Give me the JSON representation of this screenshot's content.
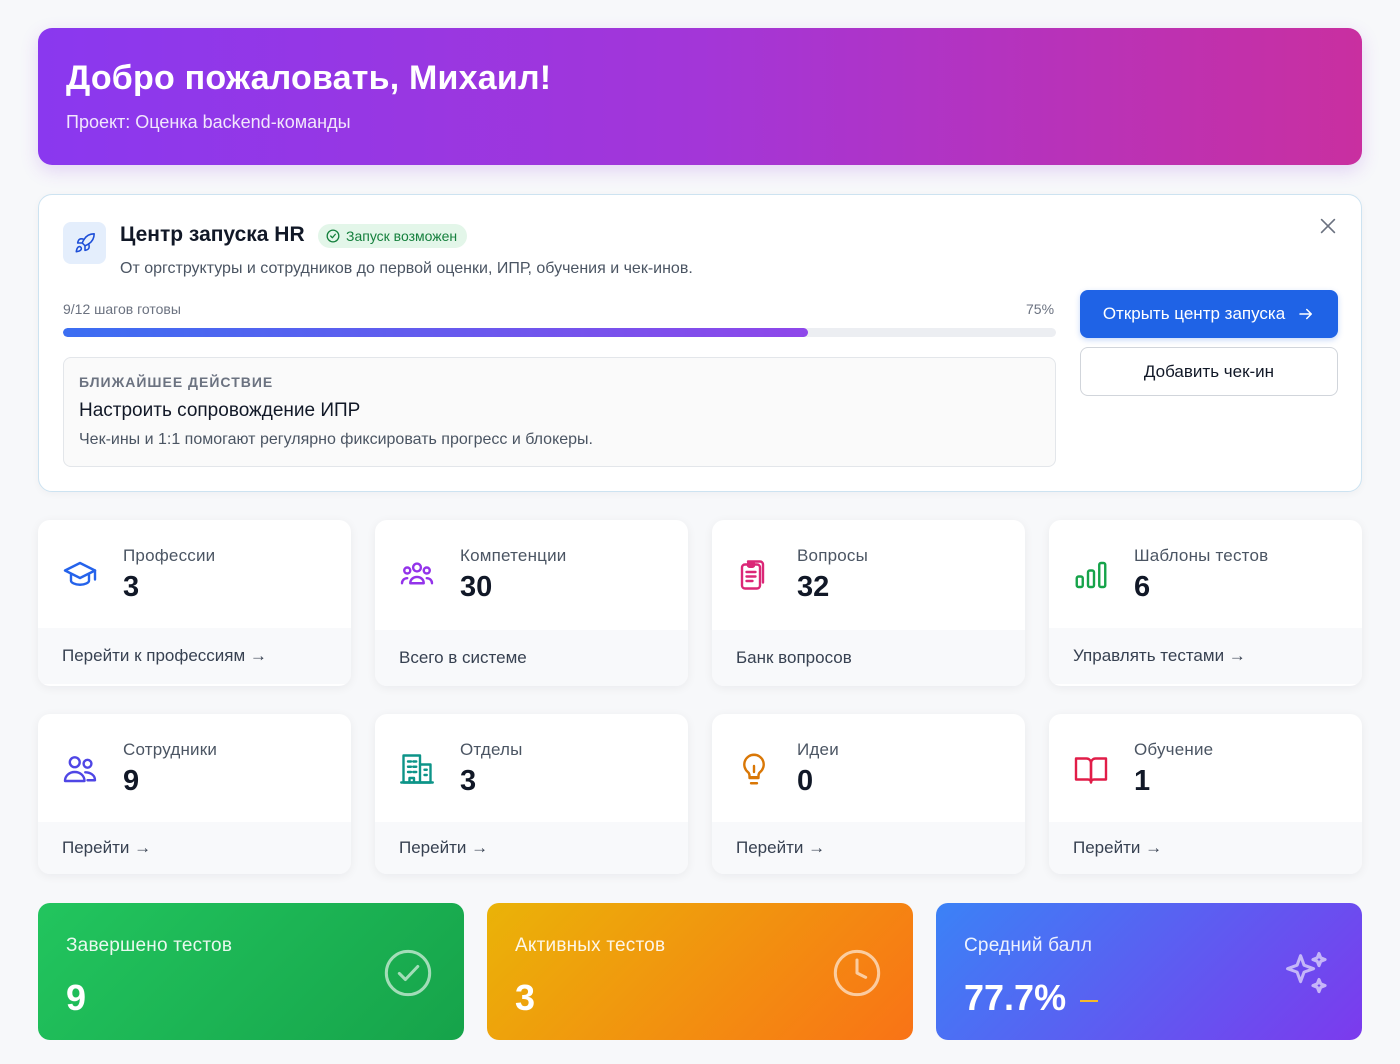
{
  "hero": {
    "title": "Добро пожаловать, Михаил!",
    "subtitle": "Проект: Оценка backend-команды"
  },
  "launch": {
    "title": "Центр запуска HR",
    "badge": "Запуск возможен",
    "subtitle": "От оргструктуры и сотрудников до первой оценки, ИПР, обучения и чек-инов.",
    "progress_label": "9/12 шагов готовы",
    "progress_percent_text": "75%",
    "progress_value": 0.75,
    "next_kicker": "БЛИЖАЙШЕЕ ДЕЙСТВИЕ",
    "next_title": "Настроить сопровождение ИПР",
    "next_desc": "Чек-ины и 1:1 помогают регулярно фиксировать прогресс и блокеры.",
    "primary_button": "Открыть центр запуска",
    "secondary_button": "Добавить чек-ин"
  },
  "cards": [
    {
      "icon": "graduation-cap-icon",
      "color": "#2563eb",
      "label": "Профессии",
      "value": "3",
      "footer": "Перейти к профессиям →"
    },
    {
      "icon": "users-group-icon",
      "color": "#9333ea",
      "label": "Компетенции",
      "value": "30",
      "footer": "Всего в системе"
    },
    {
      "icon": "clipboard-list-icon",
      "color": "#db2777",
      "label": "Вопросы",
      "value": "32",
      "footer": "Банк вопросов"
    },
    {
      "icon": "bar-chart-icon",
      "color": "#16a34a",
      "label": "Шаблоны тестов",
      "value": "6",
      "footer": "Управлять тестами →"
    },
    {
      "icon": "users-icon",
      "color": "#4f46e5",
      "label": "Сотрудники",
      "value": "9",
      "footer": "Перейти →"
    },
    {
      "icon": "building-icon",
      "color": "#0d9488",
      "label": "Отделы",
      "value": "3",
      "footer": "Перейти →"
    },
    {
      "icon": "lightbulb-icon",
      "color": "#d97706",
      "label": "Идеи",
      "value": "0",
      "footer": "Перейти →"
    },
    {
      "icon": "book-open-icon",
      "color": "#e11d48",
      "label": "Обучение",
      "value": "1",
      "footer": "Перейти →"
    }
  ],
  "stats": [
    {
      "label": "Завершено тестов",
      "value": "9",
      "icon": "check-circle-icon"
    },
    {
      "label": "Активных тестов",
      "value": "3",
      "icon": "clock-icon"
    },
    {
      "label": "Средний балл",
      "value": "77.7%",
      "icon": "sparkles-icon"
    }
  ]
}
